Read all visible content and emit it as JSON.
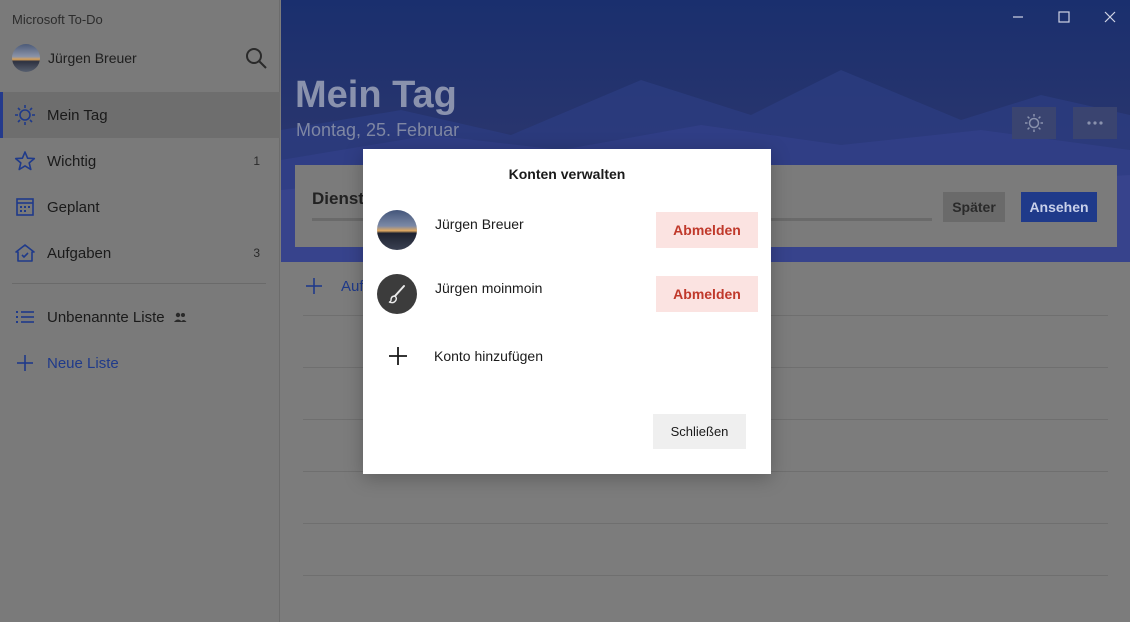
{
  "app": {
    "title": "Microsoft To-Do"
  },
  "user": {
    "name": "Jürgen Breuer"
  },
  "nav": {
    "items": [
      {
        "label": "Mein Tag",
        "count": "",
        "icon": "sun-icon"
      },
      {
        "label": "Wichtig",
        "count": "1",
        "icon": "star-icon"
      },
      {
        "label": "Geplant",
        "count": "",
        "icon": "calendar-icon"
      },
      {
        "label": "Aufgaben",
        "count": "3",
        "icon": "home-icon"
      }
    ],
    "lists": [
      {
        "label": "Unbenannte Liste",
        "icon": "list-icon"
      }
    ],
    "new_list_label": "Neue Liste"
  },
  "main": {
    "title": "Mein Tag",
    "date": "Montag, 25. Februar",
    "suggestion": {
      "title": "Dienst",
      "later_label": "Später",
      "view_label": "Ansehen"
    },
    "add_task_label": "Auf"
  },
  "dialog": {
    "title": "Konten verwalten",
    "accounts": [
      {
        "name": "Jürgen Breuer",
        "signout_label": "Abmelden"
      },
      {
        "name": "Jürgen moinmoin",
        "signout_label": "Abmelden"
      }
    ],
    "add_account_label": "Konto hinzufügen",
    "close_label": "Schließen"
  },
  "colors": {
    "accent": "#1f3a8a",
    "signout_bg": "#fbe3e1",
    "signout_text": "#c0392b"
  }
}
